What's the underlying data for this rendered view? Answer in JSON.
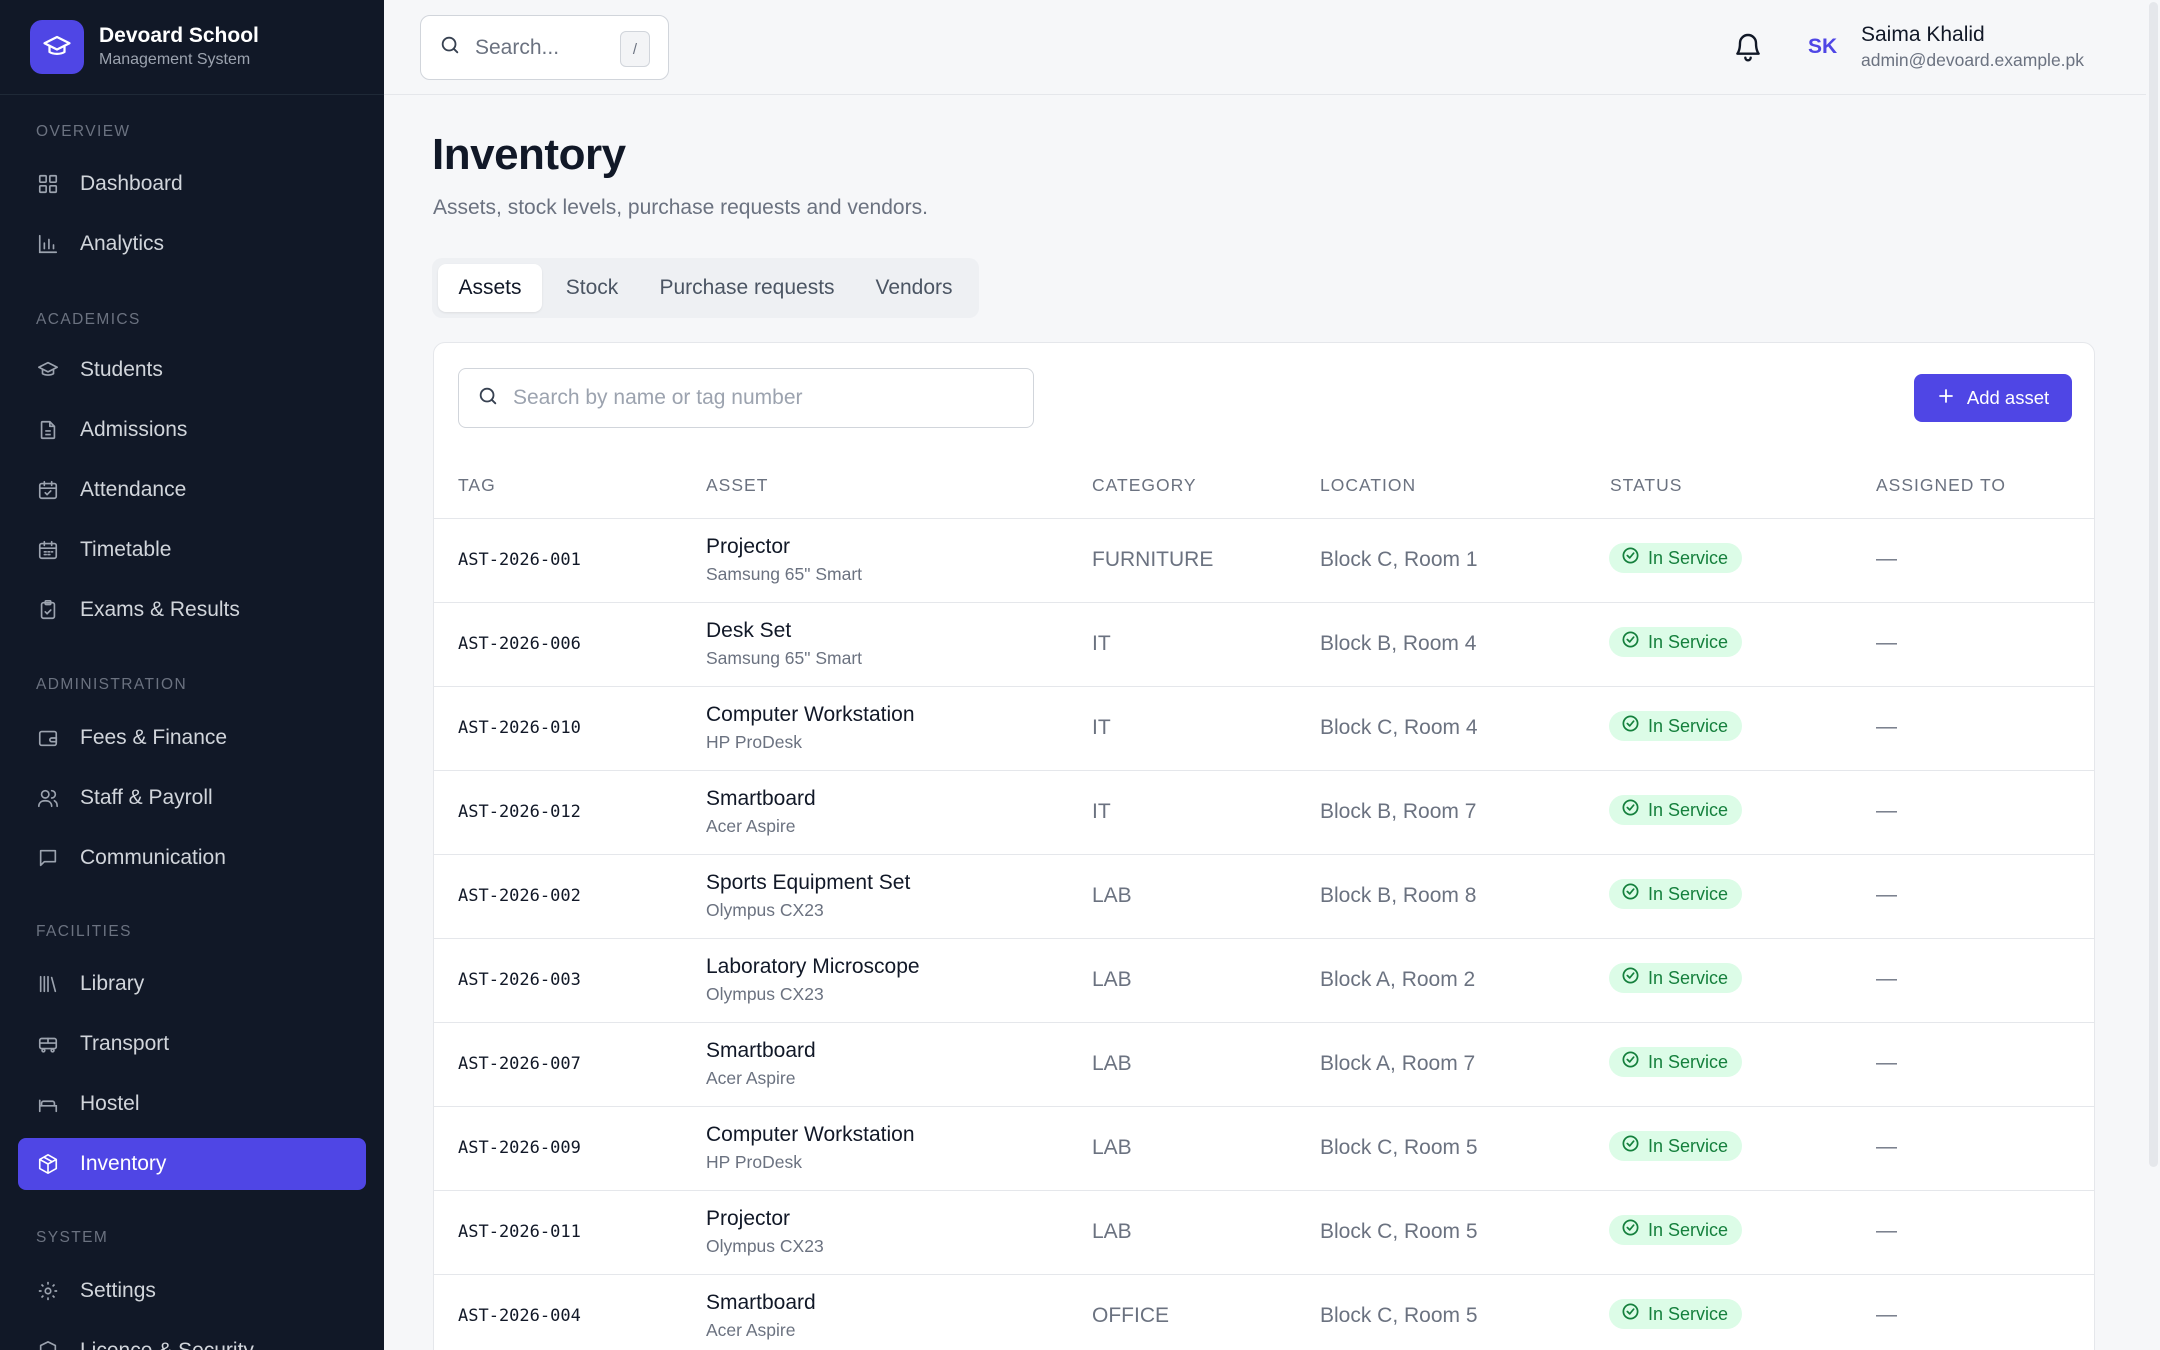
{
  "brand": {
    "title": "Devoard School",
    "subtitle": "Management System"
  },
  "sidebar": {
    "sections": [
      {
        "label": "OVERVIEW",
        "items": [
          {
            "label": "Dashboard",
            "icon": "grid-icon"
          },
          {
            "label": "Analytics",
            "icon": "bar-chart-icon"
          }
        ]
      },
      {
        "label": "ACADEMICS",
        "items": [
          {
            "label": "Students",
            "icon": "graduation-cap-icon"
          },
          {
            "label": "Admissions",
            "icon": "document-icon"
          },
          {
            "label": "Attendance",
            "icon": "calendar-check-icon"
          },
          {
            "label": "Timetable",
            "icon": "calendar-icon"
          },
          {
            "label": "Exams & Results",
            "icon": "clipboard-check-icon"
          }
        ]
      },
      {
        "label": "ADMINISTRATION",
        "items": [
          {
            "label": "Fees & Finance",
            "icon": "wallet-icon"
          },
          {
            "label": "Staff & Payroll",
            "icon": "users-icon"
          },
          {
            "label": "Communication",
            "icon": "message-icon"
          }
        ]
      },
      {
        "label": "FACILITIES",
        "items": [
          {
            "label": "Library",
            "icon": "library-icon"
          },
          {
            "label": "Transport",
            "icon": "bus-icon"
          },
          {
            "label": "Hostel",
            "icon": "bed-icon"
          },
          {
            "label": "Inventory",
            "icon": "package-icon",
            "active": true
          }
        ]
      },
      {
        "label": "SYSTEM",
        "items": [
          {
            "label": "Settings",
            "icon": "gear-icon"
          },
          {
            "label": "Licence & Security",
            "icon": "shield-icon"
          }
        ]
      }
    ]
  },
  "topbar": {
    "search_placeholder": "Search...",
    "search_shortcut": "/",
    "user": {
      "initials": "SK",
      "name": "Saima Khalid",
      "email": "admin@devoard.example.pk"
    }
  },
  "page": {
    "title": "Inventory",
    "subtitle": "Assets, stock levels, purchase requests and vendors.",
    "tabs": [
      {
        "label": "Assets",
        "active": true
      },
      {
        "label": "Stock"
      },
      {
        "label": "Purchase requests"
      },
      {
        "label": "Vendors"
      }
    ]
  },
  "table": {
    "search_placeholder": "Search by name or tag number",
    "add_label": "Add asset",
    "headers": [
      "TAG",
      "ASSET",
      "CATEGORY",
      "LOCATION",
      "STATUS",
      "ASSIGNED TO"
    ],
    "rows": [
      {
        "tag": "AST-2026-001",
        "name": "Projector",
        "model": "Samsung 65\" Smart",
        "category": "FURNITURE",
        "location": "Block C, Room 1",
        "status": "In Service",
        "assigned": "—"
      },
      {
        "tag": "AST-2026-006",
        "name": "Desk Set",
        "model": "Samsung 65\" Smart",
        "category": "IT",
        "location": "Block B, Room 4",
        "status": "In Service",
        "assigned": "—"
      },
      {
        "tag": "AST-2026-010",
        "name": "Computer Workstation",
        "model": "HP ProDesk",
        "category": "IT",
        "location": "Block C, Room 4",
        "status": "In Service",
        "assigned": "—"
      },
      {
        "tag": "AST-2026-012",
        "name": "Smartboard",
        "model": "Acer Aspire",
        "category": "IT",
        "location": "Block B, Room 7",
        "status": "In Service",
        "assigned": "—"
      },
      {
        "tag": "AST-2026-002",
        "name": "Sports Equipment Set",
        "model": "Olympus CX23",
        "category": "LAB",
        "location": "Block B, Room 8",
        "status": "In Service",
        "assigned": "—"
      },
      {
        "tag": "AST-2026-003",
        "name": "Laboratory Microscope",
        "model": "Olympus CX23",
        "category": "LAB",
        "location": "Block A, Room 2",
        "status": "In Service",
        "assigned": "—"
      },
      {
        "tag": "AST-2026-007",
        "name": "Smartboard",
        "model": "Acer Aspire",
        "category": "LAB",
        "location": "Block A, Room 7",
        "status": "In Service",
        "assigned": "—"
      },
      {
        "tag": "AST-2026-009",
        "name": "Computer Workstation",
        "model": "HP ProDesk",
        "category": "LAB",
        "location": "Block C, Room 5",
        "status": "In Service",
        "assigned": "—"
      },
      {
        "tag": "AST-2026-011",
        "name": "Projector",
        "model": "Olympus CX23",
        "category": "LAB",
        "location": "Block C, Room 5",
        "status": "In Service",
        "assigned": "—"
      },
      {
        "tag": "AST-2026-004",
        "name": "Smartboard",
        "model": "Acer Aspire",
        "category": "OFFICE",
        "location": "Block C, Room 5",
        "status": "In Service",
        "assigned": "—"
      }
    ]
  },
  "colors": {
    "accent": "#4f46e5",
    "sidebar_bg": "#111827",
    "status_bg": "#dcfce7",
    "status_text": "#15803d"
  }
}
